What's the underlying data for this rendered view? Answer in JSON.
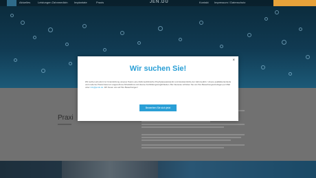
{
  "topnav": {
    "items": [
      "Aktuelles",
      "Leistungen Zahnmedizin",
      "Implantate",
      "Praxis"
    ],
    "logo": "JEN.DU",
    "right_items": [
      "Kontakt",
      "Impressum / Datenschutz"
    ]
  },
  "section": {
    "heading": "Praxi"
  },
  "modal": {
    "title": "Wir suchen Sie!",
    "close": "×",
    "body_before_link": "Wir suchen ab sofort zur Unterstützung unseres Teams eine Zahnmedizinische Prophylaxeassistentin und Assistenzärzte der zahnmedizin. Unsere qualitätsorientierte und moderne Praxis bietet ein angenehmes Arbeitsklima und diverse Fortbildungsmöglichkeiten. Bei Interesse schicken Sie uns Ihre Bewerbungsunterlagen per Mail unter ",
    "link": "info@jendu.de",
    "body_after_link": ". Wir freuen uns auf Ihre Bewerbungen!",
    "button_label": "Bewerben Sie sich jetzt"
  }
}
